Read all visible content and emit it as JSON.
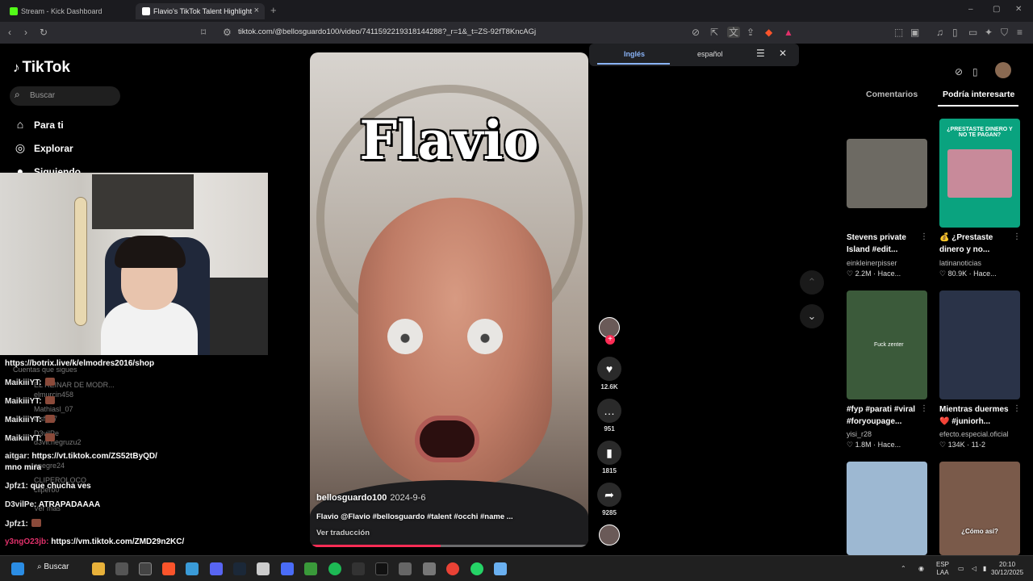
{
  "browser": {
    "tabs": [
      {
        "title": "Stream - Kick Dashboard",
        "fav_color": "#53fc18"
      },
      {
        "title": "Flavio's TikTok Talent Highlight",
        "fav_color": "#ffffff"
      }
    ],
    "url": "tiktok.com/@bellosguardo100/video/7411592219318144288?_r=1&_t=ZS-92fT8KncAGj"
  },
  "tiktok": {
    "logo": "TikTok",
    "search_placeholder": "Buscar",
    "nav": [
      {
        "label": "Para ti",
        "icon": "home-icon"
      },
      {
        "label": "Explorar",
        "icon": "compass-icon"
      },
      {
        "label": "Siguiendo",
        "icon": "following-icon"
      }
    ]
  },
  "chat": [
    {
      "user": "",
      "text": "https://botrix.live/k/elmodres2016/shop"
    },
    {
      "user": "MaikiiiYT:",
      "text": "",
      "emote": true
    },
    {
      "user": "MaikiiiYT:",
      "text": "",
      "emote": true
    },
    {
      "user": "MaikiiiYT:",
      "text": "",
      "emote": true
    },
    {
      "user": "MaikiiiYT:",
      "text": "",
      "emote": true
    },
    {
      "user": "aitgar:",
      "text": "https://vt.tiktok.com/ZS52tByQD/"
    },
    {
      "user": "",
      "text": "mno mira"
    },
    {
      "user": "Jpfz1:",
      "text": "que chucha ves"
    },
    {
      "user": "D3vilPe:",
      "text": "ATRAPADAAAA"
    },
    {
      "user": "Jpfz1:",
      "text": "",
      "emote": true
    },
    {
      "user": "y3ngO23jb:",
      "text": "https://vm.tiktok.com/ZMD29n2KC/"
    }
  ],
  "ghost_list": [
    "Cuentas que sigues",
    "EL REINAR DE MODR...",
    "elmurcin458",
    "Mathiasl_07",
    "elsf_07",
    "D3vilPe",
    "d3vil.negruzu2",
    "anegre24",
    "CLIPEROLOCO",
    "clipero0",
    "Ver más"
  ],
  "video": {
    "overlay_title": "Flavio",
    "author": "bellosguardo100",
    "date": "2024-9-6",
    "description": "Flavio @Flavio #bellosguardo #talent #occhi #name ...",
    "translate_label": "Ver traducción",
    "progress": 0.47
  },
  "actions": {
    "likes": "12.6K",
    "comments": "951",
    "saves": "1815",
    "shares": "9285"
  },
  "translate_popup": {
    "lang_source": "Inglés",
    "lang_target": "español"
  },
  "right_panel": {
    "tabs": [
      "Comentarios",
      "Podría interesarte"
    ],
    "items": [
      {
        "caption": "Stevens private Island #edit...",
        "author": "einkleinerpisser",
        "likes": "2.2M",
        "time": "Hace...",
        "thumb_color": "#6d6a63"
      },
      {
        "caption": "💰 ¿Prestaste dinero y no...",
        "author": "latinanoticias",
        "likes": "80.9K",
        "time": "Hace...",
        "thumb_color": "#0aa37f",
        "thumb_text": "¿PRESTASTE DINERO Y NO TE PAGAN?"
      },
      {
        "caption": "#fyp #parati #viral #foryoupage...",
        "author": "yisi_r28",
        "likes": "1.8M",
        "time": "Hace...",
        "thumb_color": "#3b5a3a",
        "thumb_text": "Fuck zenter"
      },
      {
        "caption": "Mientras duermes ❤️ #juniorh...",
        "author": "efecto.especial.oficial",
        "likes": "134K",
        "time": "11-2",
        "thumb_color": "#2a3348"
      },
      {
        "caption": "",
        "author": "",
        "likes": "",
        "time": "",
        "thumb_color": "#9db8d2"
      },
      {
        "caption": "",
        "author": "",
        "likes": "",
        "time": "",
        "thumb_color": "#7a5a4a",
        "thumb_text": "¿Cómo así?"
      }
    ]
  },
  "taskbar": {
    "search_label": "Buscar",
    "lang": "ESP",
    "layout": "LAA",
    "time": "20:10",
    "date": "30/12/2025"
  }
}
